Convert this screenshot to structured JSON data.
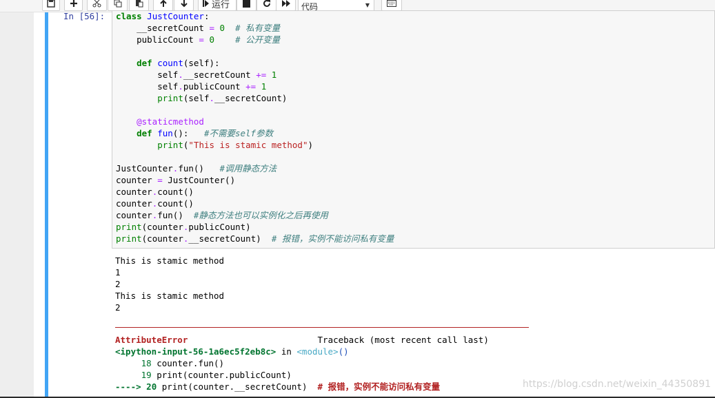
{
  "toolbar": {
    "run_label": "运行",
    "cell_type": "代码",
    "buttons": [
      "save-icon",
      "add-icon",
      "cut-icon",
      "copy-icon",
      "paste-icon",
      "move-up-icon",
      "move-down-icon",
      "run-icon",
      "stop-icon",
      "restart-icon",
      "fast-forward-icon",
      "keyboard-icon"
    ]
  },
  "cell": {
    "prompt": "In [56]:",
    "code": [
      "class JustCounter:",
      "    __secretCount = 0  # 私有变量",
      "    publicCount = 0    # 公开变量",
      "",
      "    def count(self):",
      "        self.__secretCount += 1",
      "        self.publicCount += 1",
      "        print(self.__secretCount)",
      "",
      "    @staticmethod",
      "    def fun():   #不需要self参数",
      "        print(\"This is stamic method\")",
      "",
      "JustCounter.fun()   #调用静态方法",
      "counter = JustCounter()",
      "counter.count()",
      "counter.count()",
      "counter.fun()  #静态方法也可以实例化之后再使用",
      "print(counter.publicCount)",
      "print(counter.__secretCount)  # 报错，实例不能访问私有变量"
    ]
  },
  "output": {
    "stdout": [
      "This is stamic method",
      "1",
      "2",
      "This is stamic method",
      "2"
    ],
    "traceback": {
      "error_name": "AttributeError",
      "header_right": "Traceback (most recent call last)",
      "input_ref": "<ipython-input-56-1a6ec5f2eb8c>",
      "in_text": " in ",
      "module": "<module>",
      "parens": "()",
      "line18_no": "18",
      "line18_code": "counter.fun()",
      "line19_no": "19",
      "line19_code": "print(counter.publicCount)",
      "arrow": "---->",
      "line20_no": "20",
      "line20_code": "print(counter.__secretCount)",
      "line20_comment": "# 报错，实例不能访问私有变量"
    }
  },
  "watermark": "https://blog.csdn.net/weixin_44350891",
  "colors": {
    "cell_selected_bar": "#42a5f5",
    "keyword": "#008000",
    "comment": "#408080",
    "error": "#b22222"
  }
}
